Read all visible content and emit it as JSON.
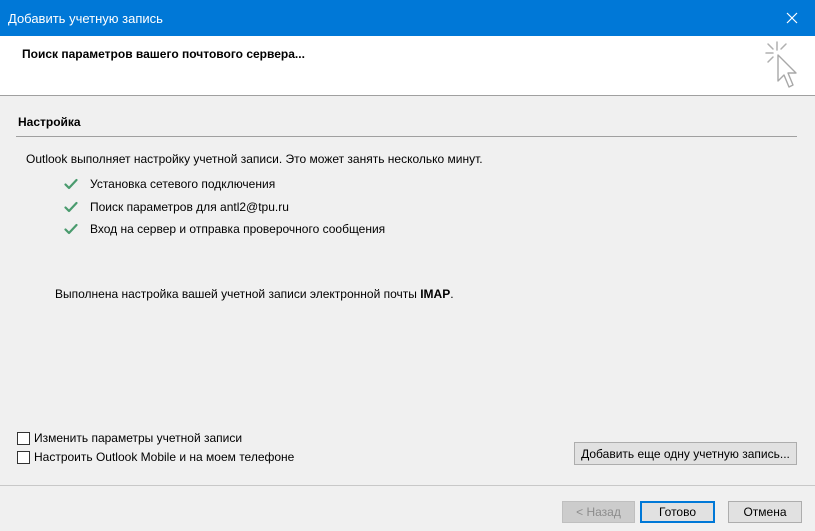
{
  "window": {
    "title": "Добавить учетную запись",
    "close_icon": "close-icon"
  },
  "header": {
    "heading": "Поиск параметров вашего почтового сервера...",
    "graphic_icon": "cursor-sparkle-icon"
  },
  "section": {
    "title": "Настройка",
    "intro": "Outlook выполняет настройку учетной записи. Это может занять несколько минут.",
    "steps": [
      {
        "label": "Установка сетевого подключения",
        "status": "done"
      },
      {
        "label": "Поиск параметров для antl2@tpu.ru",
        "status": "done"
      },
      {
        "label": "Вход на сервер и отправка проверочного сообщения",
        "status": "done"
      }
    ],
    "result_prefix": "Выполнена настройка вашей учетной записи электронной почты ",
    "result_protocol": "IMAP",
    "result_suffix": "."
  },
  "options": [
    {
      "label": "Изменить параметры учетной записи",
      "checked": false
    },
    {
      "label": "Настроить Outlook Mobile и на моем телефоне",
      "checked": false
    }
  ],
  "buttons": {
    "add_another": "Добавить еще одну учетную запись...",
    "back": "< Назад",
    "finish": "Готово",
    "cancel": "Отмена"
  },
  "colors": {
    "titlebar": "#0078d7",
    "check": "#4a9b6e"
  }
}
